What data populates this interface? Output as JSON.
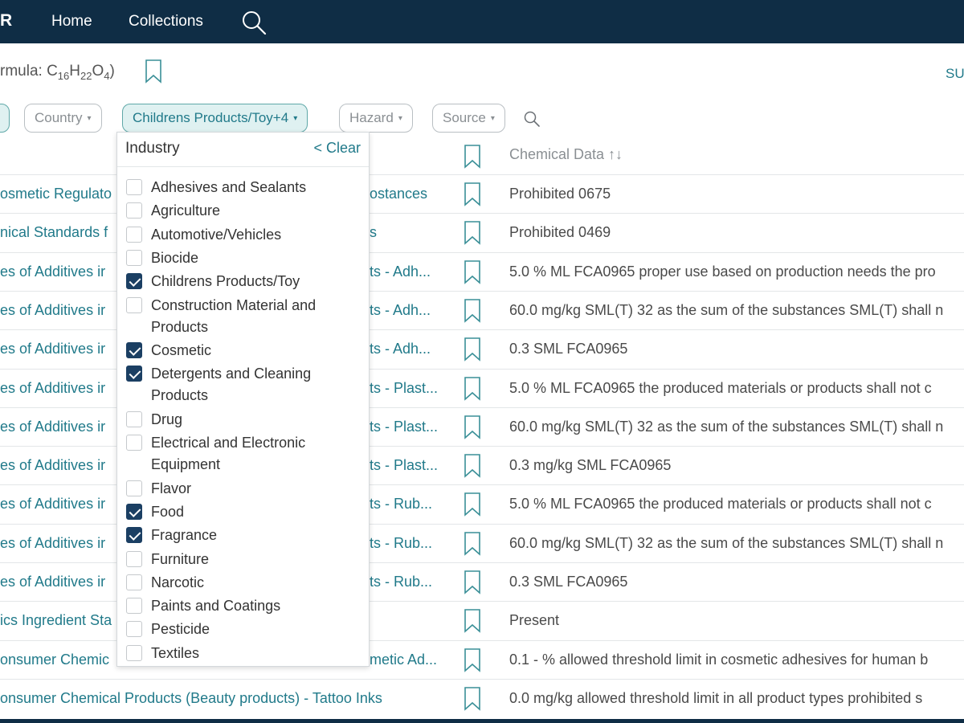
{
  "nav": {
    "brand": "R",
    "links": [
      "Home",
      "Collections"
    ]
  },
  "header": {
    "formula_prefix": "rmula: C",
    "formula_sub1": "16",
    "formula_mid1": "H",
    "formula_sub2": "22",
    "formula_mid2": "O",
    "formula_sub3": "4",
    "formula_suffix": ")",
    "right_link": "SU"
  },
  "filters": {
    "country": "Country",
    "industry": "Childrens Products/Toy+4",
    "hazard": "Hazard",
    "source": "Source",
    "caret": "▾"
  },
  "table": {
    "chemical_header": "Chemical Data ↑↓",
    "rows": [
      {
        "a": "osmetic Regulato",
        "b": "ostances",
        "c": "Prohibited 0675"
      },
      {
        "a": "nical Standards f",
        "b": "s",
        "c": "Prohibited 0469"
      },
      {
        "a": "es of Additives ir",
        "b": "ts - Adh...",
        "c": "5.0 % ML FCA0965 proper use based on production needs the pro"
      },
      {
        "a": "es of Additives ir",
        "b": "ts - Adh...",
        "c": "60.0 mg/kg SML(T) 32 as the sum of the substances SML(T) shall n"
      },
      {
        "a": "es of Additives ir",
        "b": "ts - Adh...",
        "c": "0.3 SML FCA0965"
      },
      {
        "a": "es of Additives ir",
        "b": "ts - Plast...",
        "c": "5.0 % ML FCA0965 the produced materials or products shall not c"
      },
      {
        "a": "es of Additives ir",
        "b": "ts - Plast...",
        "c": "60.0 mg/kg SML(T) 32 as the sum of the substances SML(T) shall n"
      },
      {
        "a": "es of Additives ir",
        "b": "ts - Plast...",
        "c": "0.3 mg/kg SML FCA0965"
      },
      {
        "a": "es of Additives ir",
        "b": "ts - Rub...",
        "c": "5.0 % ML FCA0965 the produced materials or products shall not c"
      },
      {
        "a": "es of Additives ir",
        "b": "ts - Rub...",
        "c": "60.0 mg/kg SML(T) 32 as the sum of the substances SML(T) shall n"
      },
      {
        "a": "es of Additives ir",
        "b": "ts - Rub...",
        "c": "0.3 SML FCA0965"
      },
      {
        "a": "ics Ingredient Sta",
        "b": "",
        "c": "Present"
      },
      {
        "a": "onsumer Chemic",
        "b": "metic Ad...",
        "c": "0.1 - % allowed threshold limit in cosmetic adhesives for human b"
      },
      {
        "a": "onsumer Chemical Products (Beauty products) - Tattoo Inks",
        "b": "",
        "c": "0.0 mg/kg allowed threshold limit in all product types prohibited s"
      }
    ]
  },
  "dropdown": {
    "title": "Industry",
    "clear": "< Clear",
    "items": [
      {
        "label": "Adhesives and Sealants",
        "checked": false
      },
      {
        "label": "Agriculture",
        "checked": false
      },
      {
        "label": "Automotive/Vehicles",
        "checked": false
      },
      {
        "label": "Biocide",
        "checked": false
      },
      {
        "label": "Childrens Products/Toy",
        "checked": true
      },
      {
        "label": "Construction Material and Products",
        "checked": false
      },
      {
        "label": "Cosmetic",
        "checked": true
      },
      {
        "label": "Detergents and Cleaning Products",
        "checked": true
      },
      {
        "label": "Drug",
        "checked": false
      },
      {
        "label": "Electrical and Electronic Equipment",
        "checked": false
      },
      {
        "label": "Flavor",
        "checked": false
      },
      {
        "label": "Food",
        "checked": true
      },
      {
        "label": "Fragrance",
        "checked": true
      },
      {
        "label": "Furniture",
        "checked": false
      },
      {
        "label": "Narcotic",
        "checked": false
      },
      {
        "label": "Paints and Coatings",
        "checked": false
      },
      {
        "label": "Pesticide",
        "checked": false
      },
      {
        "label": "Textiles",
        "checked": false
      }
    ]
  },
  "icons": {
    "nav_search": "search-icon",
    "bookmark": "bookmark-icon",
    "filter_search": "search-icon",
    "checkbox": "checkbox-icon"
  },
  "colors": {
    "navbar": "#0f2d45",
    "link_teal": "#217a8a",
    "checkbox_checked": "#1b3f63",
    "active_pill_bg": "#dff1f1"
  }
}
